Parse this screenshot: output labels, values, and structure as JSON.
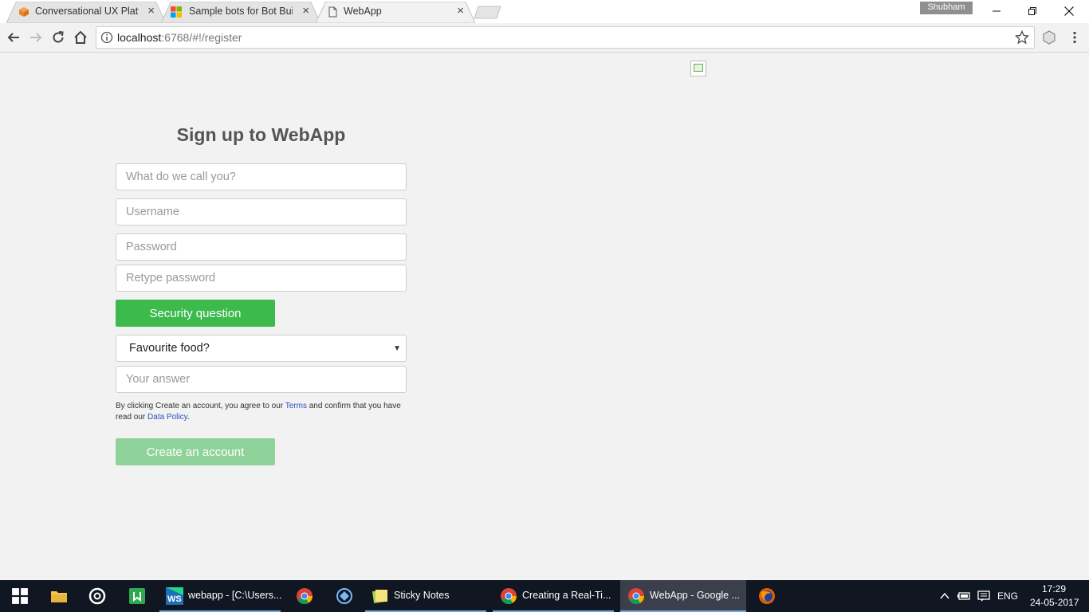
{
  "browser": {
    "tabs": [
      {
        "title": "Conversational UX Platfo",
        "favicon": "box-icon",
        "active": false
      },
      {
        "title": "Sample bots for Bot Build",
        "favicon": "microsoft-logo-icon",
        "active": false
      },
      {
        "title": "WebApp",
        "favicon": "page-icon",
        "active": true
      }
    ],
    "profile_name": "Shubham",
    "url_host": "localhost",
    "url_path": ":6768/#!/register"
  },
  "page": {
    "heading": "Sign up to WebApp",
    "name_placeholder": "What do we call you?",
    "username_placeholder": "Username",
    "password_placeholder": "Password",
    "retype_placeholder": "Retype password",
    "security_button": "Security question",
    "question_selected": "Favourite food?",
    "answer_placeholder": "Your answer",
    "terms": {
      "part1": "By clicking Create an account, you agree to our ",
      "terms_link": "Terms",
      "part2": " and confirm that you have read our ",
      "policy_link": "Data Policy",
      "part3": "."
    },
    "create_button": "Create an account",
    "colors": {
      "accent": "#3cba4c",
      "accent_disabled": "#8fd39a"
    }
  },
  "taskbar": {
    "items": [
      {
        "label": "webapp - [C:\\Users..."
      },
      {
        "label": "Sticky Notes"
      },
      {
        "label": "Creating a Real-Ti..."
      },
      {
        "label": "WebApp - Google ..."
      }
    ],
    "language": "ENG",
    "time": "17:29",
    "date": "24-05-2017"
  }
}
